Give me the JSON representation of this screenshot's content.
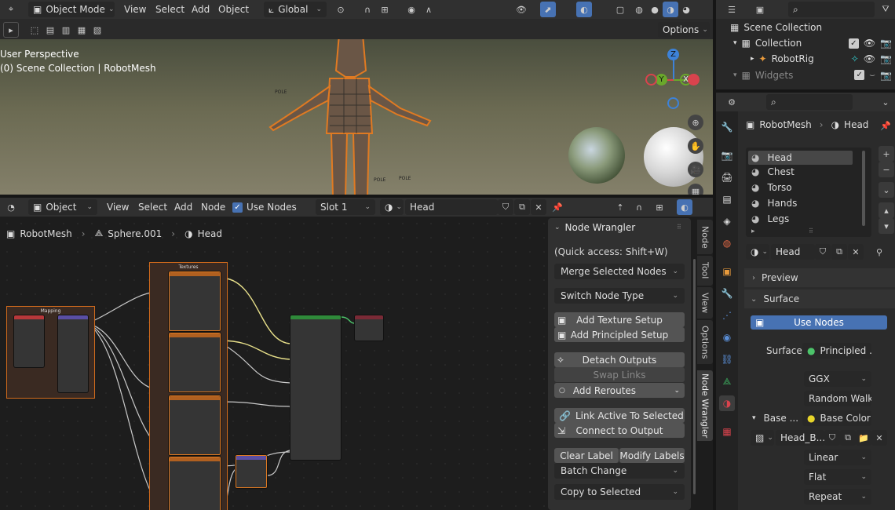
{
  "viewport": {
    "mode": "Object Mode",
    "menus": [
      "View",
      "Select",
      "Add",
      "Object"
    ],
    "transform_orientation": "Global",
    "options_label": "Options",
    "overlay_line1": "User Perspective",
    "overlay_line2": "(0) Scene Collection | RobotMesh",
    "gizmo_axes": {
      "z": "Z",
      "y": "Y",
      "x": "X"
    },
    "pole_labels": [
      "POLE",
      "POLE",
      "POLE"
    ]
  },
  "node_editor": {
    "object_selector": "Object",
    "menus": [
      "View",
      "Select",
      "Add",
      "Node"
    ],
    "use_nodes_label": "Use Nodes",
    "slot": "Slot 1",
    "material_name": "Head",
    "breadcrumb": {
      "object": "RobotMesh",
      "mesh": "Sphere.001",
      "material": "Head"
    },
    "frames": {
      "textures": "Textures",
      "mapping": "Mapping"
    }
  },
  "node_wrangler": {
    "header": "Node Wrangler",
    "hint": "(Quick access: Shift+W)",
    "merge": "Merge Selected Nodes",
    "switch": "Switch Node Type",
    "add_texture_setup": "Add Texture Setup",
    "add_principled_setup": "Add Principled Setup",
    "detach_outputs": "Detach Outputs",
    "swap_links": "Swap Links",
    "add_reroutes": "Add Reroutes",
    "link_active": "Link Active To Selected",
    "connect_output": "Connect to Output",
    "clear_label": "Clear Label",
    "modify_labels": "Modify Labels",
    "batch_change": "Batch Change",
    "copy_to_selected": "Copy to Selected",
    "tabs": [
      "Node",
      "Tool",
      "View",
      "Options",
      "Node Wrangler"
    ]
  },
  "outliner": {
    "search_placeholder": "",
    "items": [
      {
        "label": "Scene Collection"
      },
      {
        "label": "Collection"
      },
      {
        "label": "RobotRig"
      },
      {
        "label": "Widgets"
      }
    ]
  },
  "properties": {
    "breadcrumb_object": "RobotMesh",
    "breadcrumb_material": "Head",
    "materials": [
      "Head",
      "Chest",
      "Torso",
      "Hands",
      "Legs"
    ],
    "material_name": "Head",
    "preview_label": "Preview",
    "surface_label": "Surface",
    "use_nodes_label": "Use Nodes",
    "surface_field_label": "Surface",
    "surface_shader": "Principled ...",
    "distribution": "GGX",
    "subsurface": "Random Walk",
    "base_label": "Base ...",
    "base_color": "Base Color",
    "image_name": "Head_B...",
    "interpolation": "Linear",
    "projection": "Flat",
    "extension": "Repeat"
  },
  "colors": {
    "accent_blue": "#4772b3",
    "frame_orange": "#d06a1c",
    "axis_x": "#d9434d",
    "axis_y": "#6aa82b",
    "axis_z": "#3d82d8"
  }
}
